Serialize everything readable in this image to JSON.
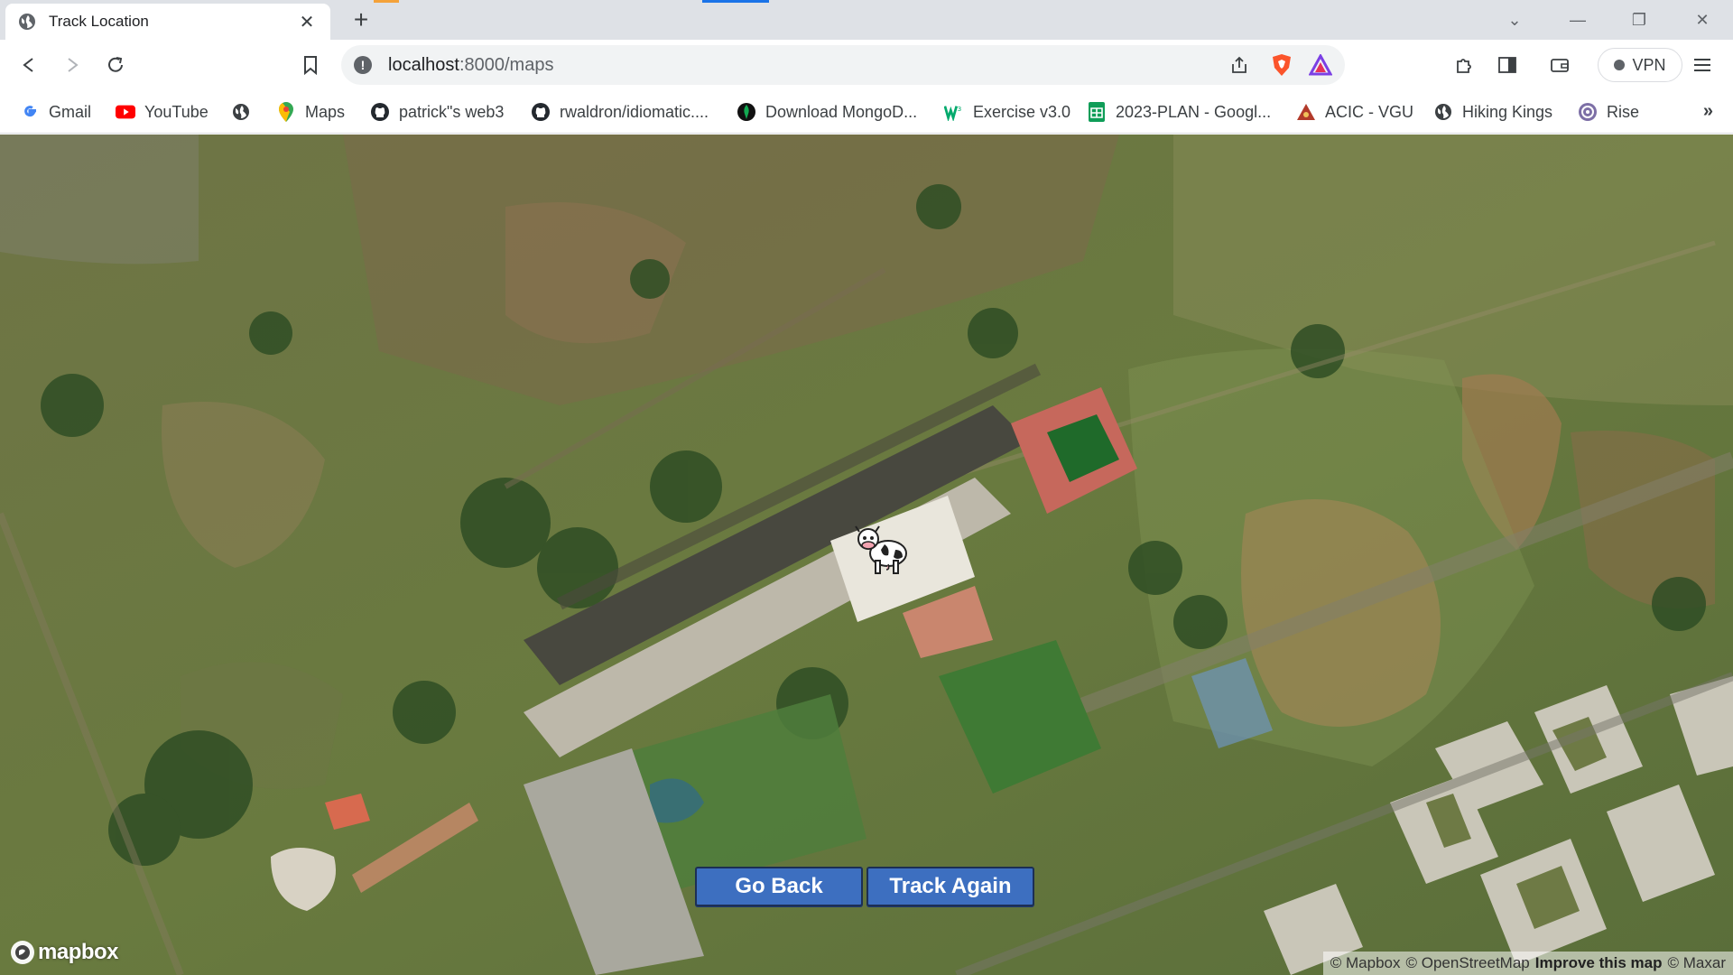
{
  "browser": {
    "tab": {
      "title": "Track Location",
      "icon": "globe-icon"
    },
    "new_tab_label": "+",
    "address": {
      "host": "localhost",
      "path": ":8000/maps"
    },
    "vpn_label": "VPN",
    "accent_color": "#1a73e8"
  },
  "bookmarks": [
    {
      "label": "Gmail",
      "icon": "gmail-icon"
    },
    {
      "label": "YouTube",
      "icon": "youtube-icon"
    },
    {
      "label": "",
      "icon": "globe-icon"
    },
    {
      "label": "Maps",
      "icon": "maps-icon"
    },
    {
      "label": "patrick\"s web3",
      "icon": "github-icon"
    },
    {
      "label": "rwaldron/idiomatic....",
      "icon": "github-icon"
    },
    {
      "label": "Download MongoD...",
      "icon": "mongodb-icon"
    },
    {
      "label": "Exercise v3.0",
      "icon": "w3schools-icon"
    },
    {
      "label": "2023-PLAN - Googl...",
      "icon": "sheets-icon"
    },
    {
      "label": "ACIC - VGU",
      "icon": "acic-icon"
    },
    {
      "label": "Hiking Kings",
      "icon": "globe-icon"
    },
    {
      "label": "Rise",
      "icon": "rise-icon"
    }
  ],
  "map": {
    "marker_icon": "cow-icon",
    "buttons": {
      "go_back": "Go Back",
      "track_again": "Track Again"
    },
    "button_color": "#3d6fc0",
    "logo": "mapbox",
    "attribution": {
      "mapbox": "© Mapbox",
      "osm": "© OpenStreetMap",
      "improve": "Improve this map",
      "maxar": "© Maxar"
    }
  }
}
